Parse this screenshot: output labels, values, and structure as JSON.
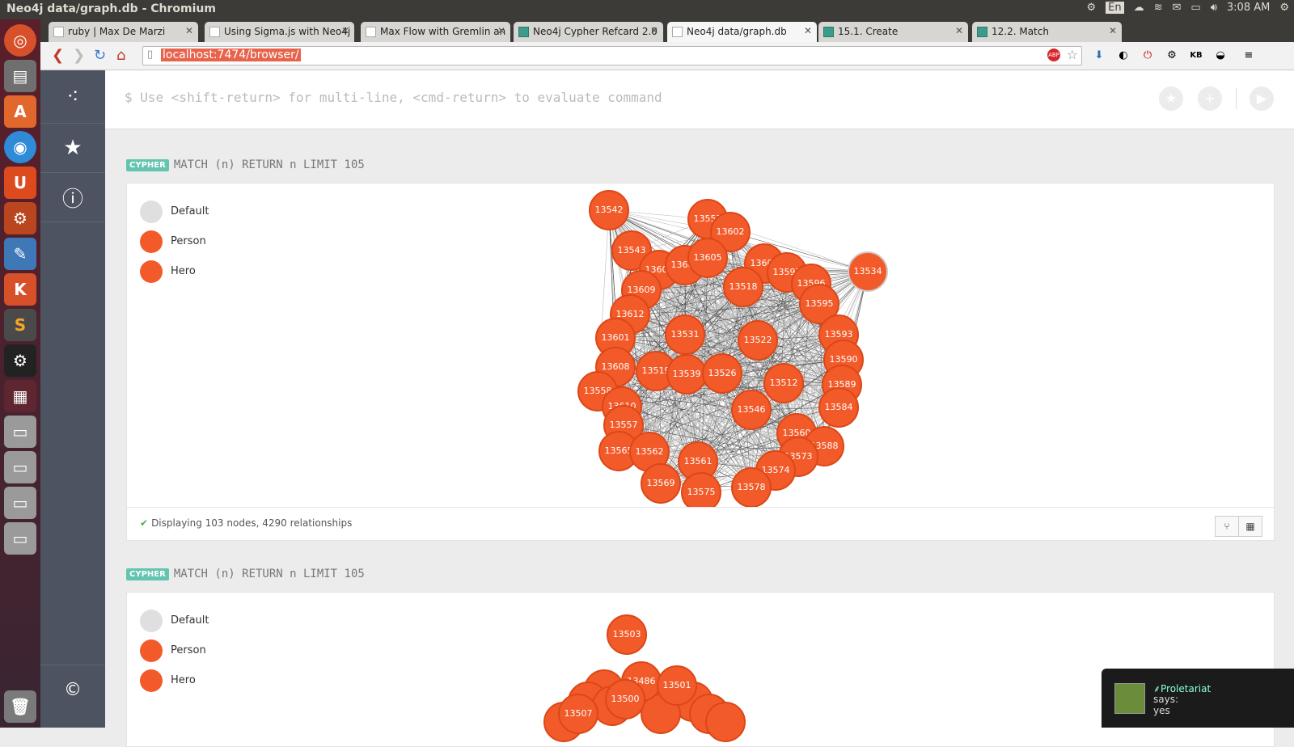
{
  "window_title": "Neo4j data/graph.db - Chromium",
  "tray": {
    "lang": "En",
    "time": "3:08 AM"
  },
  "tabs": [
    {
      "label": "ruby | Max De Marzi",
      "fav": "page"
    },
    {
      "label": "Using Sigma.js with Neo4j",
      "fav": "page"
    },
    {
      "label": "Max Flow with Gremlin an",
      "fav": "page"
    },
    {
      "label": "Neo4j Cypher Refcard 2.0",
      "fav": "neo"
    },
    {
      "label": "Neo4j data/graph.db",
      "fav": "page",
      "active": true
    },
    {
      "label": "15.1. Create",
      "fav": "neo"
    },
    {
      "label": "12.2. Match",
      "fav": "neo"
    }
  ],
  "url": "localhost:7474/browser/",
  "editor": {
    "prompt": "$ Use <shift-return> for multi-line, <cmd-return> to evaluate command"
  },
  "frames": [
    {
      "badge": "CYPHER",
      "query": "MATCH (n) RETURN n LIMIT 105",
      "legend": [
        {
          "label": "Default",
          "color": "#dfdfdf"
        },
        {
          "label": "Person",
          "color": "#f25a29"
        },
        {
          "label": "Hero",
          "color": "#f25a29"
        }
      ],
      "status": "Displaying 103 nodes, 4290 relationships",
      "nodes": [
        "13542",
        "13557",
        "13602",
        "13543",
        "13607",
        "13606",
        "13605",
        "13603",
        "13597",
        "13596",
        "13534",
        "13609",
        "13518",
        "13595",
        "13612",
        "13593",
        "13531",
        "13601",
        "13522",
        "13590",
        "13608",
        "13519",
        "13539",
        "13526",
        "13512",
        "13589",
        "13558",
        "13610",
        "13546",
        "13584",
        "13557",
        "13560",
        "13588",
        "13565",
        "13562",
        "13561",
        "13573",
        "13574",
        "13569",
        "13575",
        "13578"
      ]
    },
    {
      "badge": "CYPHER",
      "query": "MATCH (n) RETURN n LIMIT 105",
      "legend": [
        {
          "label": "Default",
          "color": "#dfdfdf"
        },
        {
          "label": "Person",
          "color": "#f25a29"
        },
        {
          "label": "Hero",
          "color": "#f25a29"
        }
      ],
      "nodes": [
        "13503",
        "13486",
        "13501",
        "13500",
        "13507"
      ]
    }
  ],
  "notification": {
    "user": "Proletariat",
    "says": "says:",
    "message": "yes"
  }
}
